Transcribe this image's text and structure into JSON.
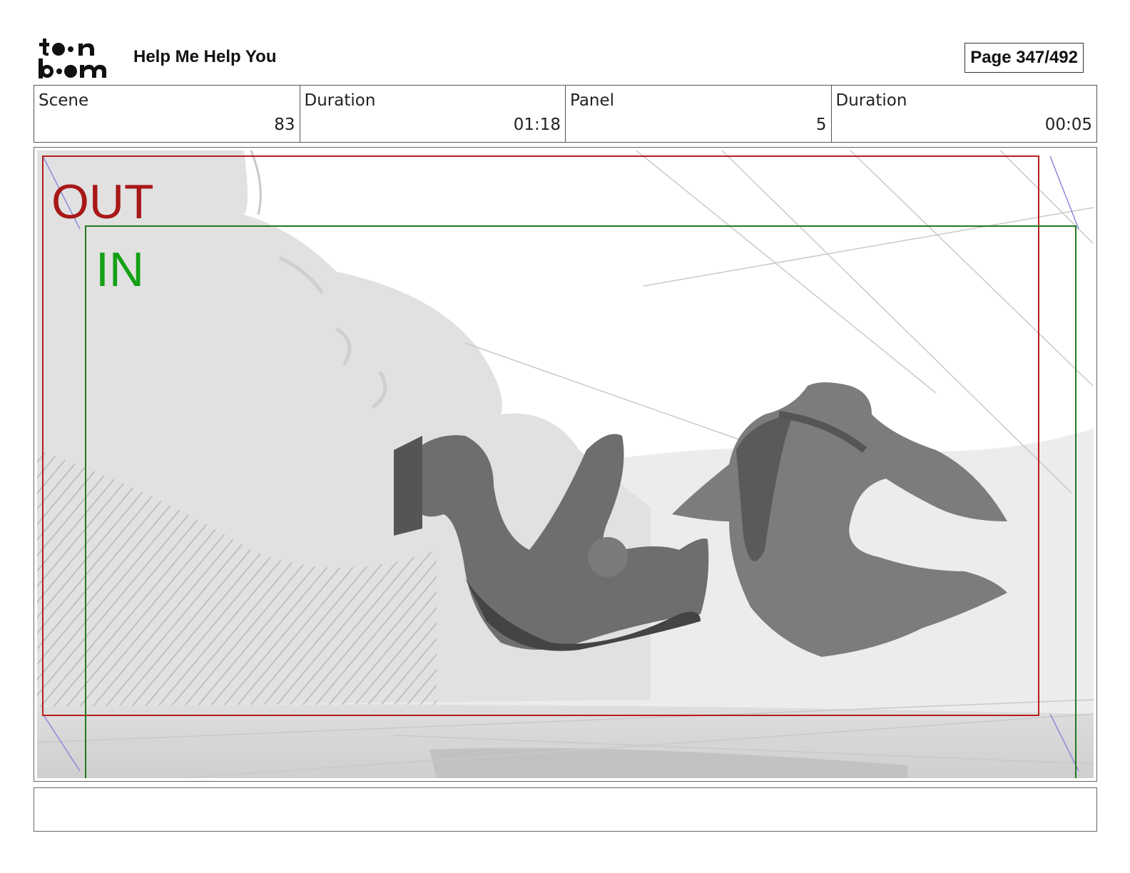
{
  "header": {
    "logo_line1": "toon",
    "logo_line2": "boom",
    "project_title": "Help Me Help You",
    "page_indicator": "Page 347/492"
  },
  "info": {
    "scene_label": "Scene",
    "scene_value": "83",
    "scene_duration_label": "Duration",
    "scene_duration_value": "01:18",
    "panel_label": "Panel",
    "panel_value": "5",
    "panel_duration_label": "Duration",
    "panel_duration_value": "00:05"
  },
  "panel": {
    "out_label": "OUT",
    "in_label": "IN",
    "out_frame_color": "#b81c1c",
    "in_frame_color": "#1f7a1f"
  },
  "notes": {
    "text": ""
  }
}
